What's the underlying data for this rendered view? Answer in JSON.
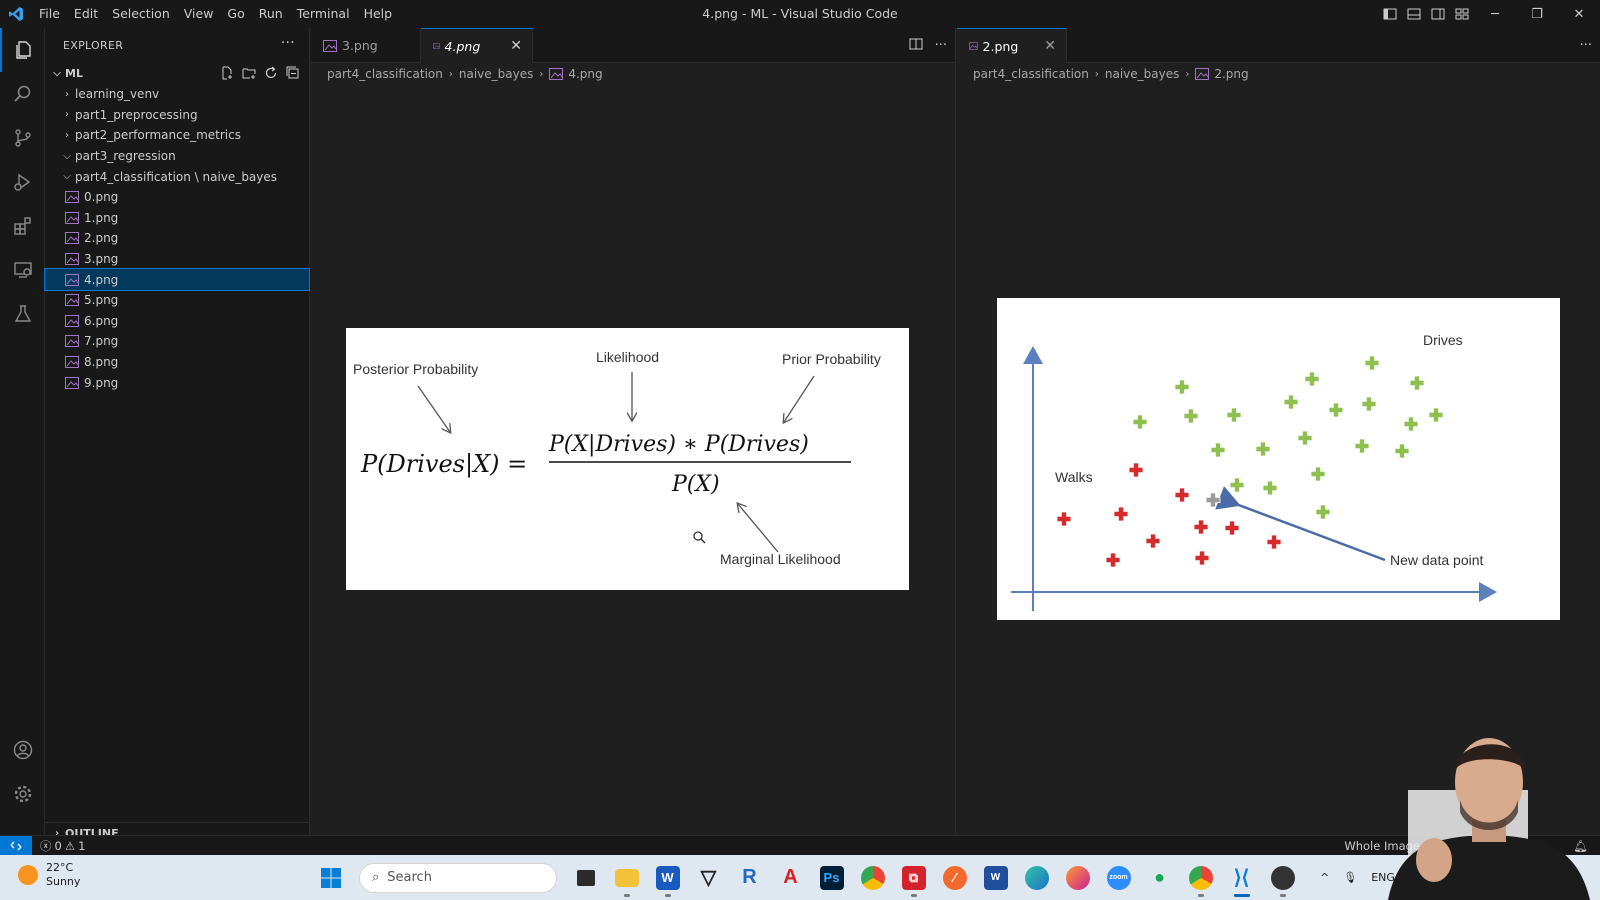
{
  "titlebar": {
    "menu": [
      "File",
      "Edit",
      "Selection",
      "View",
      "Go",
      "Run",
      "Terminal",
      "Help"
    ],
    "window_title": "4.png - ML - Visual Studio Code"
  },
  "sidebar": {
    "header": "EXPLORER",
    "root": "ML",
    "items": [
      {
        "label": "learning_venv",
        "kind": "folder",
        "expanded": false
      },
      {
        "label": "part1_preprocessing",
        "kind": "folder",
        "expanded": false
      },
      {
        "label": "part2_performance_metrics",
        "kind": "folder",
        "expanded": false
      },
      {
        "label": "part3_regression",
        "kind": "folder",
        "expanded": true
      },
      {
        "label": "part4_classification \\ naive_bayes",
        "kind": "folder",
        "expanded": true
      },
      {
        "label": "0.png",
        "kind": "file"
      },
      {
        "label": "1.png",
        "kind": "file"
      },
      {
        "label": "2.png",
        "kind": "file"
      },
      {
        "label": "3.png",
        "kind": "file"
      },
      {
        "label": "4.png",
        "kind": "file",
        "selected": true
      },
      {
        "label": "5.png",
        "kind": "file"
      },
      {
        "label": "6.png",
        "kind": "file"
      },
      {
        "label": "7.png",
        "kind": "file"
      },
      {
        "label": "8.png",
        "kind": "file"
      },
      {
        "label": "9.png",
        "kind": "file"
      }
    ],
    "outline": "OUTLINE"
  },
  "editor_left": {
    "tabs": [
      {
        "label": "3.png"
      },
      {
        "label": "4.png",
        "active": true
      }
    ],
    "breadcrumb": [
      "part4_classification",
      "naive_bayes",
      "4.png"
    ],
    "image": {
      "posterior_label": "Posterior Probability",
      "likelihood_label": "Likelihood",
      "prior_label": "Prior Probability",
      "marginal_label": "Marginal Likelihood",
      "formula_lhs": "P(Drives|X) =",
      "formula_numerator": "P(X|Drives) ∗ P(Drives)",
      "formula_denominator": "P(X)"
    }
  },
  "editor_right": {
    "tabs": [
      {
        "label": "2.png",
        "active": true
      }
    ],
    "breadcrumb": [
      "part4_classification",
      "naive_bayes",
      "2.png"
    ],
    "image": {
      "drives_label": "Drives",
      "walks_label": "Walks",
      "new_point_label": "New data point"
    }
  },
  "statusbar": {
    "errors": "0",
    "warnings": "1",
    "whole_image": "Whole Image"
  },
  "taskbar": {
    "temperature": "22°C",
    "condition": "Sunny",
    "search_placeholder": "Search",
    "language": "ENG"
  },
  "colors": {
    "accent": "#0078d4",
    "walks_marker": "#d62b2b",
    "drives_marker": "#8fbf4f",
    "new_point_marker": "#9a9a9a",
    "axis": "#5b7fbf"
  }
}
